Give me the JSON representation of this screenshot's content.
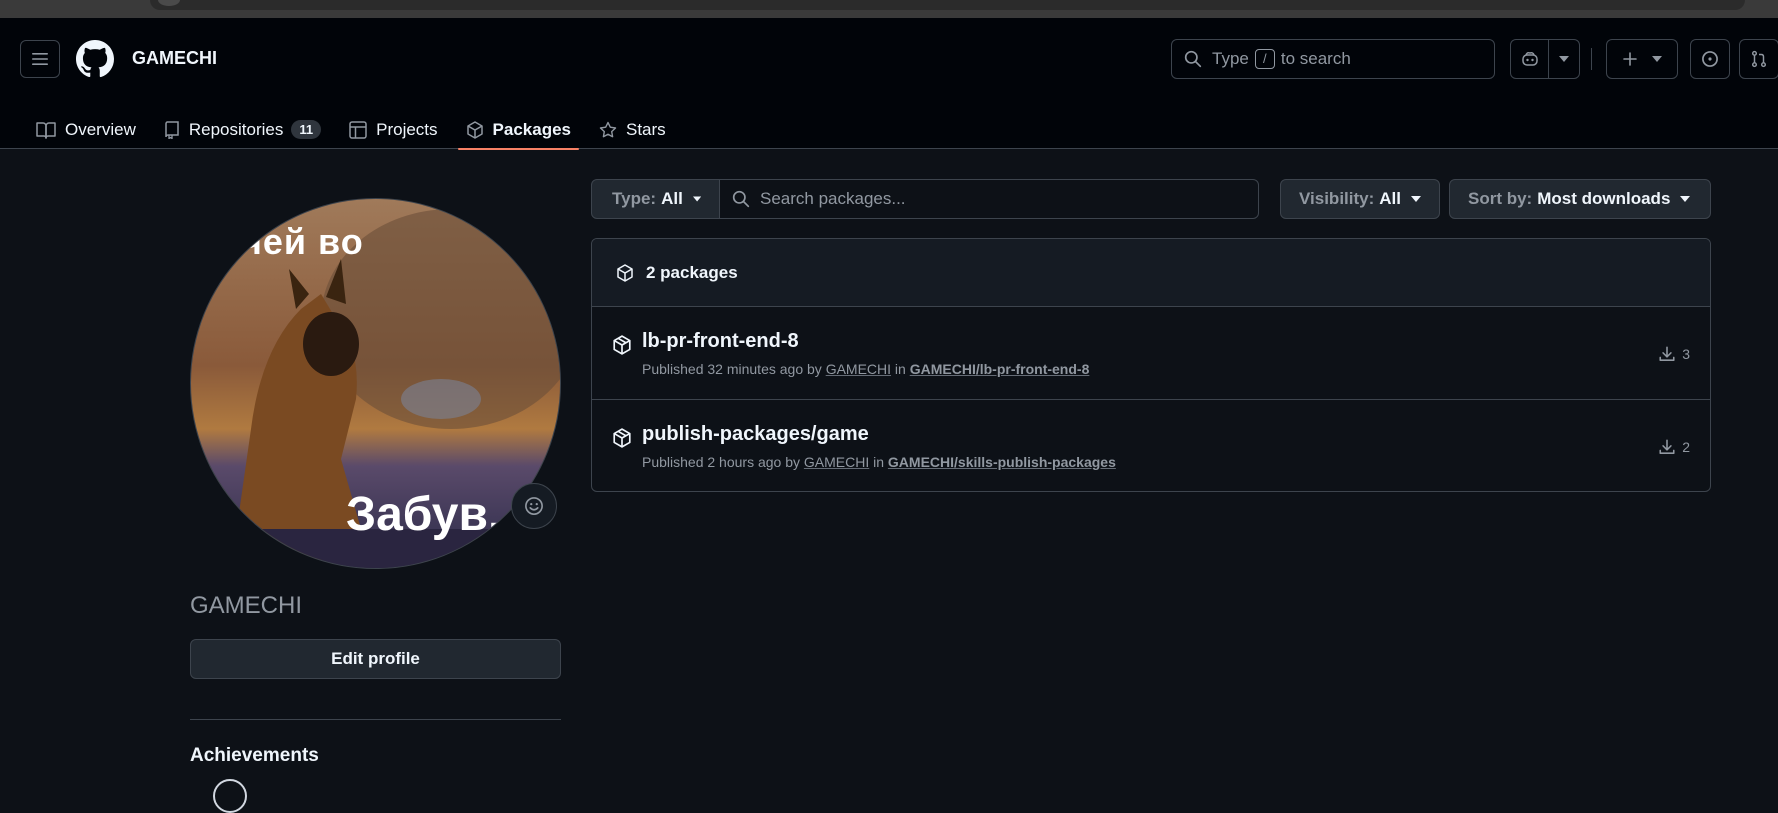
{
  "header": {
    "title": "GAMECHI",
    "search": {
      "prefix": "Type",
      "key": "/",
      "suffix": "to search"
    }
  },
  "tabs": [
    {
      "label": "Overview",
      "icon": "book-icon"
    },
    {
      "label": "Repositories",
      "icon": "repo-icon",
      "count": "11"
    },
    {
      "label": "Projects",
      "icon": "table-icon"
    },
    {
      "label": "Packages",
      "icon": "package-icon",
      "selected": true
    },
    {
      "label": "Stars",
      "icon": "star-icon"
    }
  ],
  "sidebar": {
    "avatar_text_top": "чей во",
    "avatar_text_bottom": "Забув.",
    "name": "GAMECHI",
    "edit_profile": "Edit profile",
    "achievements": "Achievements"
  },
  "filters": {
    "type_label": "Type:",
    "type_value": "All",
    "search_placeholder": "Search packages...",
    "visibility_label": "Visibility:",
    "visibility_value": "All",
    "sort_label": "Sort by:",
    "sort_value": "Most downloads"
  },
  "packages": {
    "count_label": "2 packages",
    "items": [
      {
        "name": "lb-pr-front-end-8",
        "published": "Published 32 minutes ago by",
        "author": "GAMECHI",
        "in": "in",
        "repo": "GAMECHI/lb-pr-front-end-8",
        "downloads": "3"
      },
      {
        "name": "publish-packages/game",
        "published": "Published 2 hours ago by",
        "author": "GAMECHI",
        "in": "in",
        "repo": "GAMECHI/skills-publish-packages",
        "downloads": "2"
      }
    ]
  },
  "colors": {
    "background": "#0d1117",
    "header_bg": "#010409",
    "border": "#3d444d",
    "accent_underline": "#f78166",
    "muted_text": "#9198a1"
  }
}
